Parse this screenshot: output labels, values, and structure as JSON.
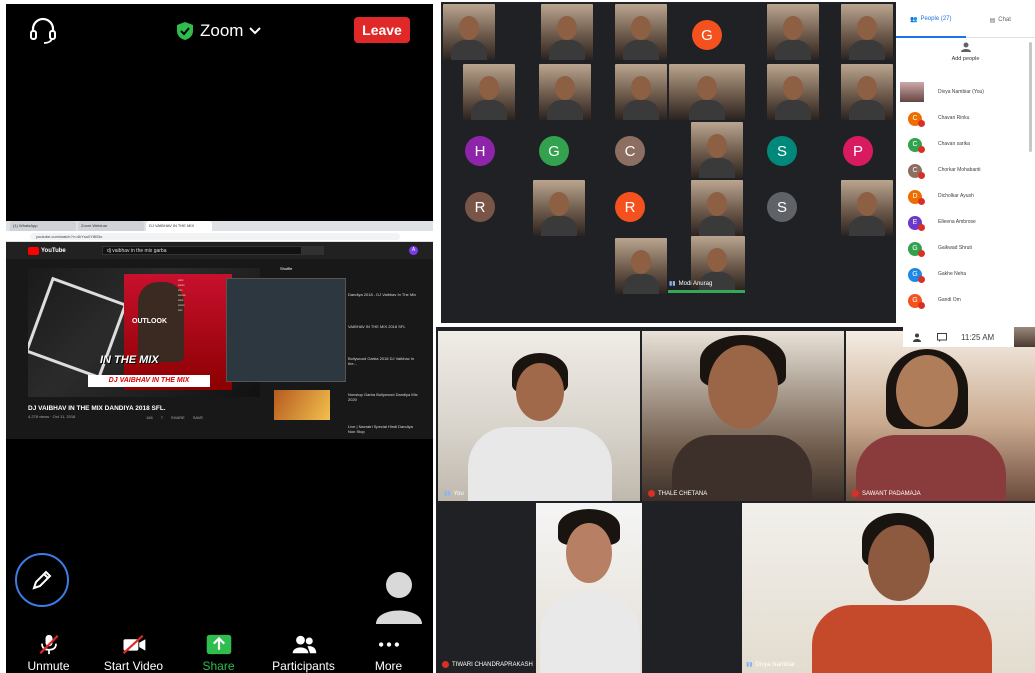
{
  "zoom": {
    "title": "Zoom",
    "leave_label": "Leave",
    "toolbar": [
      {
        "label": "Unmute",
        "icon": "muted-mic-icon"
      },
      {
        "label": "Start Video",
        "icon": "video-off-icon"
      },
      {
        "label": "Share",
        "icon": "share-arrow-icon"
      },
      {
        "label": "Participants",
        "icon": "participants-icon"
      },
      {
        "label": "More",
        "icon": "more-dots-icon"
      }
    ],
    "share_accent": "#2fbd4e",
    "leave_color": "#e02828"
  },
  "shared_screen": {
    "tabs": [
      "(1) WhatsApp",
      "Zoom Webinar",
      "DJ VAIBHAV IN THE MIX"
    ],
    "url": "youtube.com/watch?v=4kYsu0Y8B3o",
    "search_query": "dj vaibhav in the mix garba",
    "youtube_label": "YouTube",
    "video_title": "DJ VAIBHAV IN THE MIX DANDIYA 2018 SFL.",
    "video_meta": "4,278 views · Oct 11, 2018",
    "actions": [
      "166",
      "7",
      "SHARE",
      "SAVE"
    ],
    "thumb_text_mix": "IN THE MIX",
    "thumb_text_dj": "DJ VAIBHAV IN THE MIX",
    "thumb_logo": "OUTLOOK",
    "upnext_label": "Shuffle",
    "side_items": [
      {
        "title": "Dandiya 2018 - DJ Vaibhav In The Mix"
      },
      {
        "title": "VAIBHAV IN THE MIX 2018 SFL"
      },
      {
        "title": "Bollywood Garba 2018 DJ Vaibhav In the..."
      },
      {
        "title": "Nonstop Garba Bollywood Dandiya Mix 2020"
      },
      {
        "title": "Live | Navratri Special Hindi Dandiya Non Stop"
      }
    ]
  },
  "meet": {
    "active_label": "Modi Anurag",
    "avatars": [
      {
        "letter": "G",
        "color": "#f4511e"
      },
      {
        "letter": "H",
        "color": "#8e24aa"
      },
      {
        "letter": "G",
        "color": "#33a24f"
      },
      {
        "letter": "C",
        "color": "#8d6e63"
      },
      {
        "letter": "S",
        "color": "#00897b"
      },
      {
        "letter": "P",
        "color": "#d81b60"
      },
      {
        "letter": "R",
        "color": "#795548"
      },
      {
        "letter": "R",
        "color": "#f4511e"
      },
      {
        "letter": "S",
        "color": "#5f6368"
      }
    ],
    "people_tab": "People (27)",
    "chat_tab": "Chat",
    "add_people": "Add people",
    "participants": [
      {
        "name": "Divya Nambiar (You)",
        "initial": "",
        "color": ""
      },
      {
        "name": "Chavan Rinku",
        "initial": "C",
        "color": "#ef6c00"
      },
      {
        "name": "Chavan sarika",
        "initial": "C",
        "color": "#33a24f"
      },
      {
        "name": "Chorkar Mohabanti",
        "initial": "C",
        "color": "#8d6e63"
      },
      {
        "name": "Dicholkar Ayush",
        "initial": "D",
        "color": "#ef6c00"
      },
      {
        "name": "Elleena Ambrose",
        "initial": "E",
        "color": "#6a39c9"
      },
      {
        "name": "Gaikwad Shruti",
        "initial": "G",
        "color": "#33a24f"
      },
      {
        "name": "Gakhe Neha",
        "initial": "G",
        "color": "#1e88e5"
      },
      {
        "name": "Gandi Om",
        "initial": "G",
        "color": "#f4511e"
      }
    ]
  },
  "speaker": {
    "time": "11:25 AM",
    "labels": [
      "You",
      "THALE CHETANA",
      "SAWANT PADAMAJA",
      "TIWARI CHANDRAPRAKASH",
      "Divya Nambiar"
    ]
  }
}
